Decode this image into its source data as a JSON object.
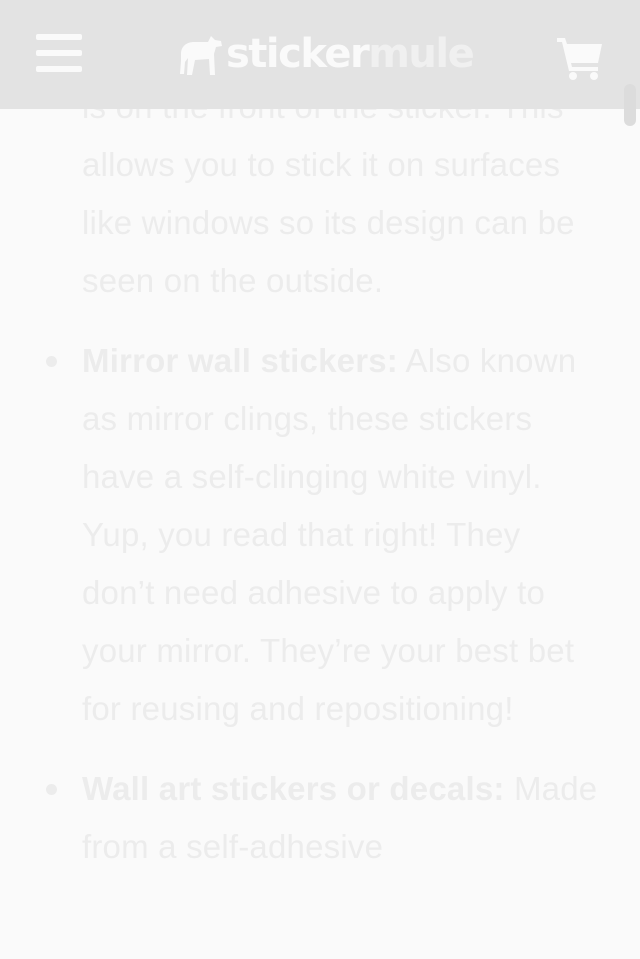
{
  "header": {
    "logo_part_1": "sticker",
    "logo_part_2": "mule",
    "menu_icon": "hamburger-menu-icon",
    "cart_icon": "shopping-cart-icon"
  },
  "article": {
    "continued_paragraph": "is on the front of the sticker. This allows you to stick it on surfaces like windows so its design can be seen on the outside.",
    "items": [
      {
        "term": "Mirror wall stickers:",
        "text": " Also known as mirror clings, these stickers have a self-clinging white vinyl. Yup, you read that right! They don’t need adhesive to apply to your mirror. They’re your best bet for reusing and repositioning!"
      },
      {
        "term": "Wall art stickers or decals:",
        "text": " Made from a self-adhesive"
      }
    ]
  },
  "colors": {
    "header_bg": "#e3e3e3",
    "page_bg": "#fafafa",
    "text": "#ececec"
  }
}
